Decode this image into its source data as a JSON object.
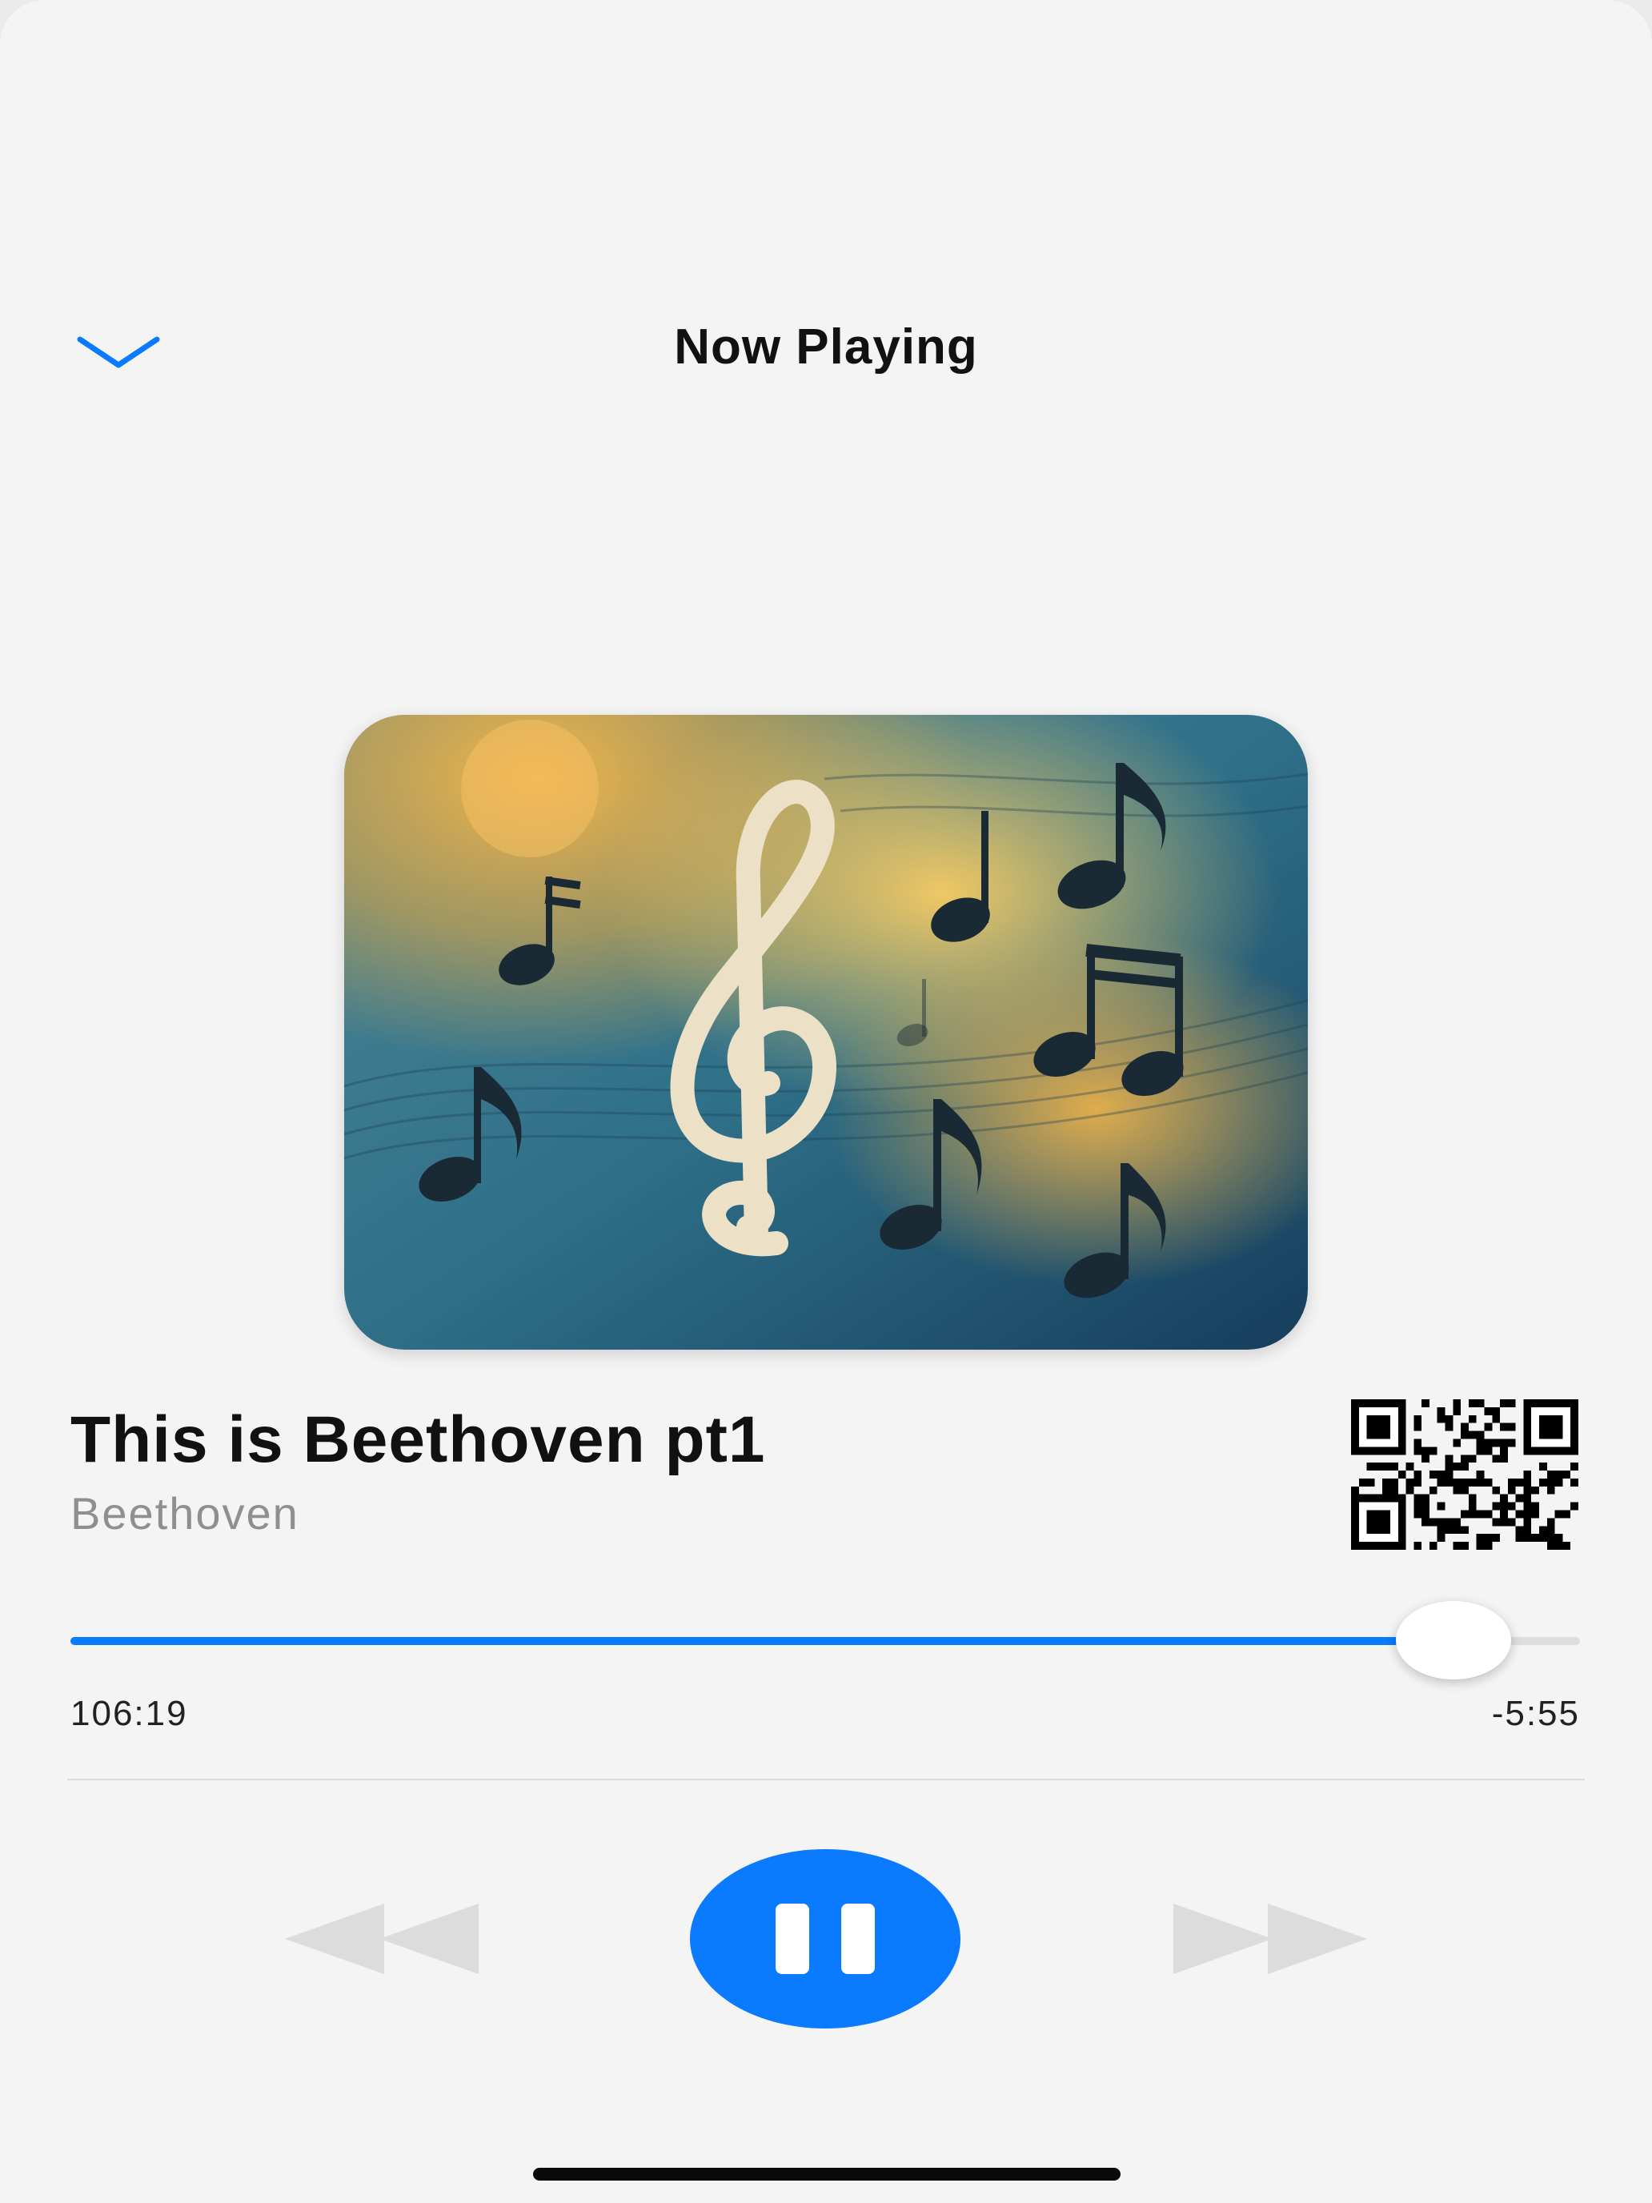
{
  "header": {
    "title": "Now Playing",
    "collapse_icon": "chevron-down-icon"
  },
  "artwork": {
    "description_icon": "treble-clef-music-notes-artwork"
  },
  "track": {
    "title": "This is Beethoven pt1",
    "artist": "Beethoven",
    "qr_icon": "qr-code-icon"
  },
  "playback": {
    "elapsed": "106:19",
    "remaining": "-5:55",
    "progress_fraction": 0.916
  },
  "controls": {
    "rewind_icon": "rewind-icon",
    "pause_icon": "pause-icon",
    "forward_icon": "fast-forward-icon"
  },
  "colors": {
    "accent": "#0a7aff",
    "background": "#f4f4f4",
    "secondary_text": "#8e8e93",
    "disabled_control": "#dcdcdc"
  }
}
